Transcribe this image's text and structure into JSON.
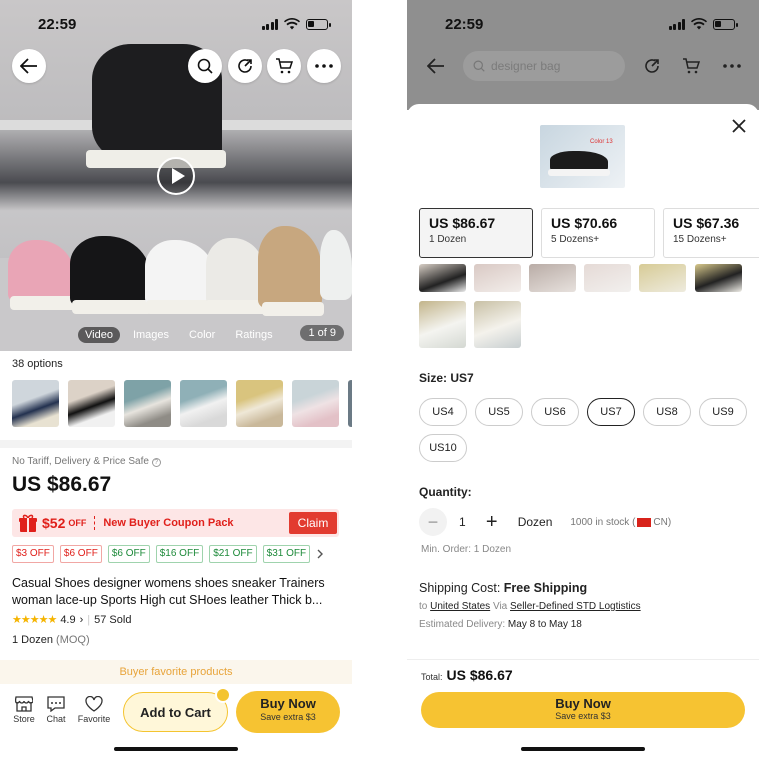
{
  "left": {
    "status": {
      "time": "22:59"
    },
    "media_tabs": [
      "Video",
      "Images",
      "Color",
      "Ratings"
    ],
    "pager": "1 of 9",
    "options_label": "38 options",
    "tariff_note": "No Tariff, Delivery & Price Safe",
    "price": "US $86.67",
    "coupon": {
      "amount": "$52",
      "off": "OFF",
      "text": "New Buyer Coupon Pack",
      "claim": "Claim"
    },
    "chips": [
      "$3 OFF",
      "$6 OFF",
      "$6 OFF",
      "$16 OFF",
      "$21 OFF",
      "$31 OFF"
    ],
    "title": "Casual Shoes designer womens shoes sneaker Trainers woman lace-up Sports High cut SHoes leather Thick b...",
    "rating": {
      "score": "4.9",
      "sold": "57 Sold"
    },
    "moq": {
      "qty": "1 Dozen",
      "note": "(MOQ)"
    },
    "favorite_band": "Buyer favorite products",
    "bottom": {
      "store": "Store",
      "chat": "Chat",
      "favorite": "Favorite",
      "add_to_cart": "Add to Cart",
      "buy_now": "Buy Now",
      "buy_now_sub": "Save extra $3"
    }
  },
  "right": {
    "status": {
      "time": "22:59"
    },
    "search_placeholder": "designer bag",
    "product_thumb_label": "Color 13",
    "tiers": [
      {
        "price": "US $86.67",
        "qty": "1 Dozen"
      },
      {
        "price": "US $70.66",
        "qty": "5 Dozens+"
      },
      {
        "price": "US $67.36",
        "qty": "15 Dozens+"
      }
    ],
    "size": {
      "label": "Size:",
      "value": "US7",
      "options": [
        "US4",
        "US5",
        "US6",
        "US7",
        "US8",
        "US9",
        "US10"
      ]
    },
    "quantity": {
      "label": "Quantity:",
      "value": "1",
      "unit": "Dozen",
      "stock": "1000 in stock (",
      "origin": "CN)",
      "min_order": "Min. Order: 1 Dozen"
    },
    "shipping": {
      "label": "Shipping Cost:",
      "value": "Free Shipping",
      "to": "to",
      "country": "United States",
      "via": "Via",
      "method": "Seller-Defined STD Logtistics",
      "eta_label": "Estimated Delivery:",
      "eta": "May 8 to May 18"
    },
    "total": {
      "label": "Total:",
      "value": "US $86.67"
    },
    "buy_now": "Buy Now",
    "buy_now_sub": "Save extra $3"
  }
}
